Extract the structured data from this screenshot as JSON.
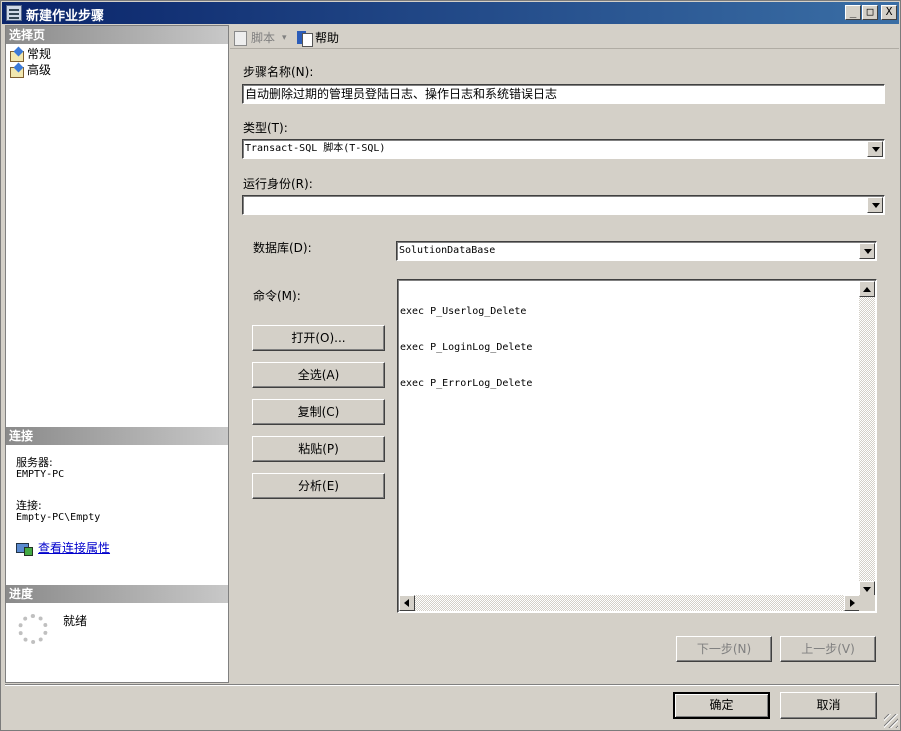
{
  "window": {
    "title": "新建作业步骤",
    "controls": {
      "minimize": "_",
      "maximize": "□",
      "close": "X"
    }
  },
  "left_pane": {
    "select_page": {
      "header": "选择页",
      "items": [
        {
          "label": "常规",
          "icon": "page-icon",
          "selected": true
        },
        {
          "label": "高级",
          "icon": "page-icon",
          "selected": false
        }
      ]
    },
    "connection": {
      "header": "连接",
      "server_label": "服务器:",
      "server_value": "EMPTY-PC",
      "connection_label": "连接:",
      "connection_value": "Empty-PC\\Empty",
      "view_properties_link": "查看连接属性"
    },
    "progress": {
      "header": "进度",
      "status": "就绪"
    }
  },
  "toolbar": {
    "script_label": "脚本",
    "help_label": "帮助"
  },
  "form": {
    "step_name_label": "步骤名称(N):",
    "step_name_value": "自动删除过期的管理员登陆日志、操作日志和系统错误日志",
    "type_label": "类型(T):",
    "type_value": "Transact-SQL 脚本(T-SQL)",
    "run_as_label": "运行身份(R):",
    "run_as_value": "",
    "database_label": "数据库(D):",
    "database_value": "SolutionDataBase",
    "command_label": "命令(M):",
    "command_lines": [
      "exec P_Userlog_Delete",
      "exec P_LoginLog_Delete",
      "exec P_ErrorLog_Delete"
    ],
    "buttons": {
      "open": "打开(O)...",
      "select_all": "全选(A)",
      "copy": "复制(C)",
      "paste": "粘贴(P)",
      "parse": "分析(E)"
    }
  },
  "nav_buttons": {
    "next": "下一步(N)",
    "previous": "上一步(V)"
  },
  "dialog_buttons": {
    "ok": "确定",
    "cancel": "取消"
  }
}
